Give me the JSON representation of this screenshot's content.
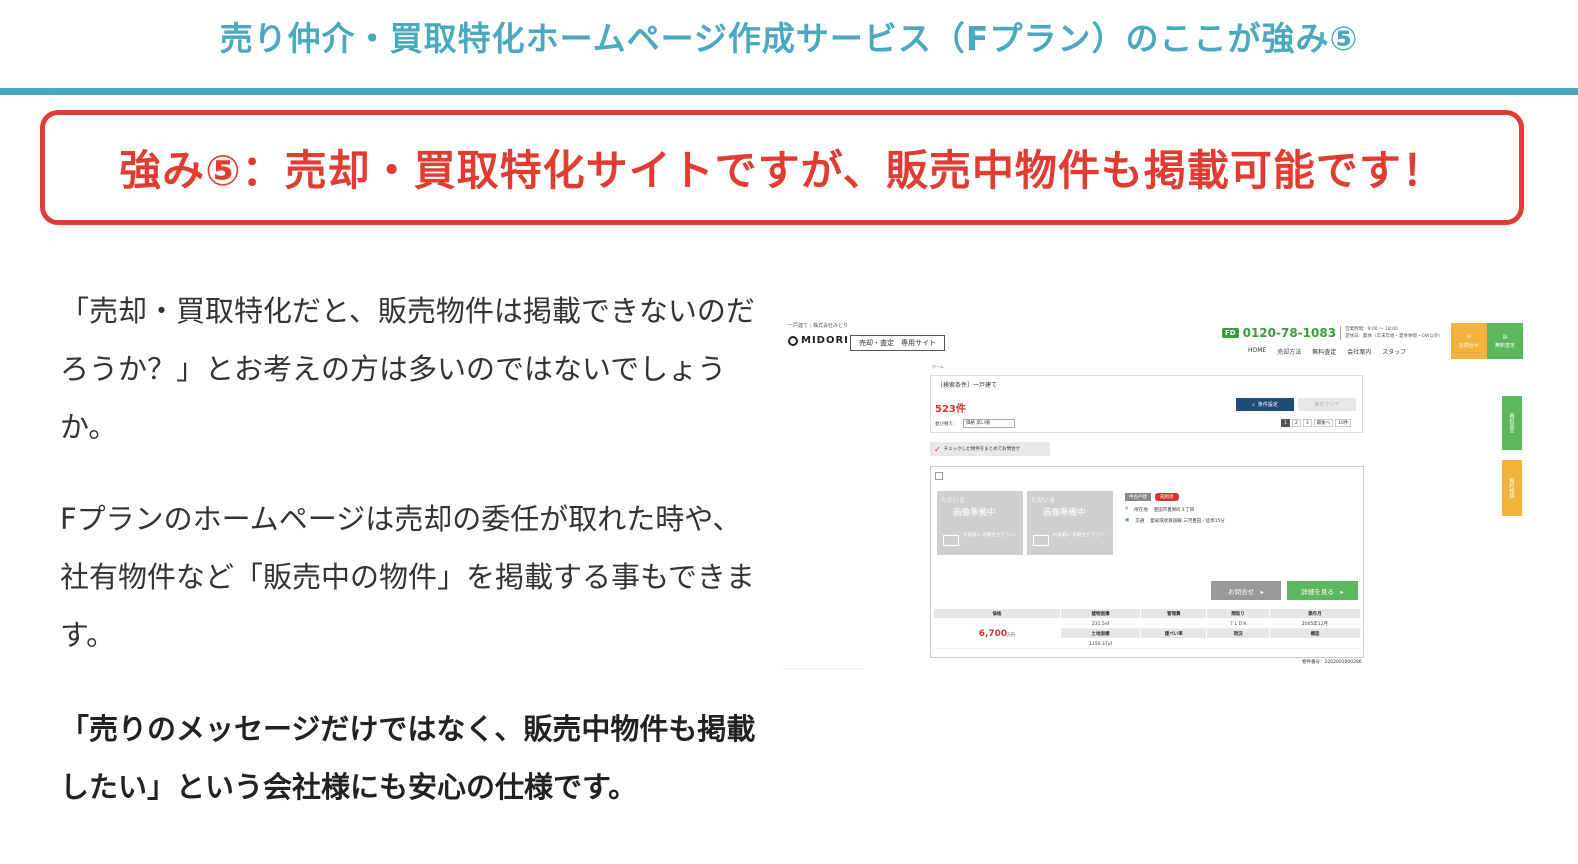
{
  "slide": {
    "title": "売り仲介・買取特化ホームページ作成サービス（Fプラン）のここが強み⑤",
    "headline": "強み⑤：売却・買取特化サイトですが、販売中物件も掲載可能です！",
    "paragraph1": "「売却・買取特化だと、販売物件は掲載できないのだろうか？」とお考えの方は多いのではないでしょうか。",
    "paragraph2": "Fプランのホームページは売却の委任が取れた時や、社有物件など「販売中の物件」を掲載する事もできます。",
    "paragraph3": "「売りのメッセージだけではなく、販売中物件も掲載したい」という会社様にも安心の仕様です。",
    "colors": {
      "accent": "#4aa8bf",
      "alert": "#e03c31"
    }
  },
  "site": {
    "tagline": "一戸建て｜株式会社みどり",
    "logo": "MIDORI",
    "site_badge": "売却・査定　専用サイト",
    "phone_icon": "FD",
    "phone": "0120-78-1083",
    "hours_line1": "営業時間：9:00 ～ 18:00",
    "hours_line2": "定休日：無休（年末年始・夏季休暇・GW以外）",
    "nav": [
      "HOME",
      "売却方法",
      "無料査定",
      "会社案内",
      "スタッフ"
    ],
    "cta_mail": "お問合せ",
    "cta_assess": "無料査定",
    "side_green": "無料査定",
    "side_orange": "無料相談",
    "crumb": "ホーム",
    "search_condition": "［検索条件］一戸建て",
    "result_count": "523件",
    "btn_condition": "条件設定",
    "btn_clear": "条件クリア",
    "sort_label": "並び替え：",
    "sort_value": "価格 高い順",
    "pages": [
      "1",
      "2",
      "3",
      "最後へ"
    ],
    "per_page": "10件",
    "bulk_inquiry": "チェックした物件をまとめてお問合せ",
    "photo_now": "ただいま",
    "photo_preparing": "画像準備中",
    "photo_contact": "お気軽に お問合せ下さい。",
    "tag_type": "中古戸建",
    "tag_status": "成約済",
    "location_label": "所在地",
    "location_value": "豊田市豊栄町３丁目",
    "access_label": "交通",
    "access_value": "愛知環状鉄道線 三河豊田／徒歩15分",
    "btn_inquiry": "お問合せ　▸",
    "btn_detail": "詳細を見る　▸",
    "spec_headers": [
      "価格",
      "建物面積",
      "管理費",
      "間取り",
      "築年月"
    ],
    "spec_headers2": [
      "土地面積",
      "建ぺい率",
      "現況",
      "構造"
    ],
    "price_value": "6,700",
    "price_unit": "万円",
    "building_area": "231.5㎡",
    "layout": "７ＬＤＫ",
    "built": "2005年12月",
    "land_area": "1150.37㎡",
    "property_no": "物件番号：2202001000286"
  }
}
